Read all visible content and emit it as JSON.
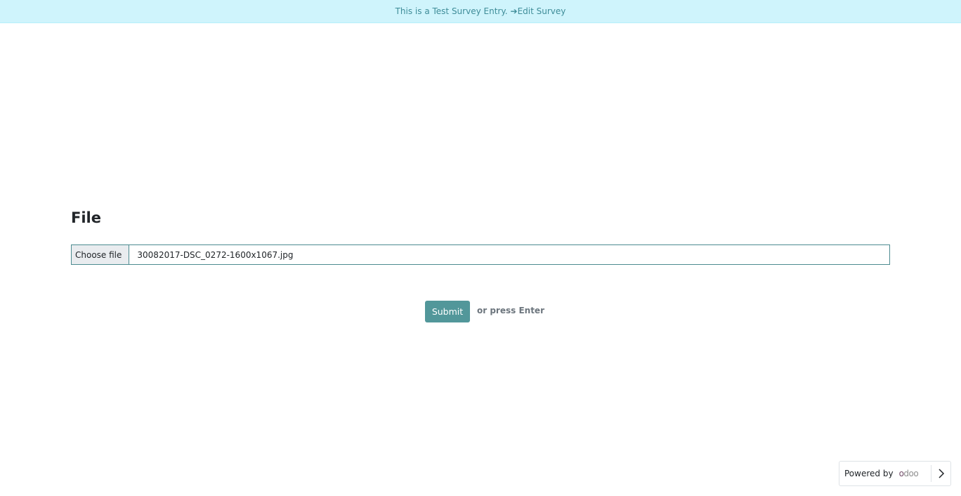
{
  "banner": {
    "text": "This is a Test Survey Entry.",
    "arrow": "➔",
    "edit_link": "Edit Survey",
    "background": "#cff4fc",
    "color": "#3f8d99"
  },
  "question": {
    "title": "File"
  },
  "file_input": {
    "button_label": "Choose file",
    "file_name": "30082017-DSC_0272-1600x1067.jpg"
  },
  "actions": {
    "submit_label": "Submit",
    "press_hint": "or press Enter",
    "accent": "#52979a"
  },
  "footer": {
    "powered_by": "Powered by",
    "logo_text": "odoo",
    "chevron_icon": "chevron-right-icon"
  }
}
